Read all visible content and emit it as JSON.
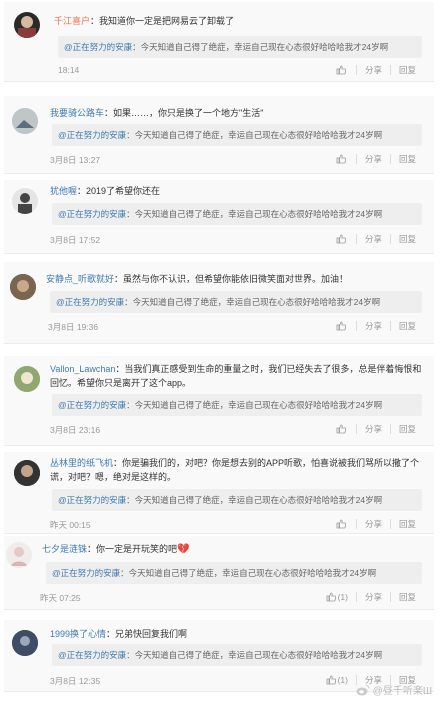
{
  "quote_prefix": "@正在努力的安康",
  "quote_text": "：今天知道自己得了绝症，幸运自己现在心态很好哈哈哈我才24岁啊",
  "actions": {
    "share": "分享",
    "reply": "回复"
  },
  "comments": [
    {
      "user": "千江喜户",
      "text": "：我知道你一定是把网易云了卸载了",
      "time": "18:14",
      "likes": ""
    },
    {
      "user": "我要骑公路车",
      "text": "：如果……，你只是换了一个地方\"生活\"",
      "time": "3月8日 13:27",
      "likes": ""
    },
    {
      "user": "犹他喔",
      "text": "：2019了希望你还在",
      "time": "3月8日 17:52",
      "likes": ""
    },
    {
      "user": "安静点_听歌就好",
      "text": "：虽然与你不认识，但希望你能依旧微笑面对世界。加油！",
      "time": "3月8日 19:36",
      "likes": ""
    },
    {
      "user": "Vallon_Lawchan",
      "text": "：当我们真正感受到生命的重量之时，我们已经失去了很多，总是伴着悔恨和回忆。希望你只是离开了这个app。",
      "time": "3月8日 23:16",
      "likes": ""
    },
    {
      "user": "丛林里的纸飞机",
      "text": "：你是骗我们的，对吧？你是想去别的APP听歌，怕喜说被我们骂所以撒了个谎，对吧？嗯，绝对是这样的。",
      "time": "昨天 00:15",
      "likes": ""
    },
    {
      "user": "七夕是涟铢",
      "text": "：你一定是开玩笑的吧",
      "time": "昨天 07:25",
      "likes": "(1)"
    },
    {
      "user": "1999换了心情",
      "text": "：兄弟快回复我们啊",
      "time": "3月8日 12:35",
      "likes": "(1)"
    }
  ],
  "watermark": "@昼千听楽Ш",
  "colors": {
    "accent": "#eb7350",
    "link": "#3f7ab0",
    "heart": "#d94040"
  }
}
